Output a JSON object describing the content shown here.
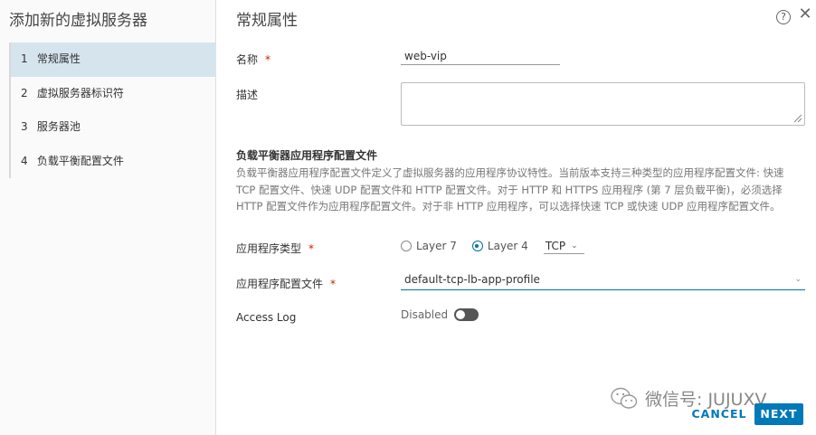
{
  "wizard": {
    "title": "添加新的虚拟服务器"
  },
  "steps": [
    {
      "num": "1",
      "label": "常规属性"
    },
    {
      "num": "2",
      "label": "虚拟服务器标识符"
    },
    {
      "num": "3",
      "label": "服务器池"
    },
    {
      "num": "4",
      "label": "负载平衡配置文件"
    }
  ],
  "page": {
    "title": "常规属性",
    "help": "?",
    "close": "✕"
  },
  "fields": {
    "name_label": "名称",
    "name_value": "web-vip",
    "required_mark": "*",
    "desc_label": "描述",
    "desc_value": ""
  },
  "profile_section": {
    "title": "负载平衡器应用程序配置文件",
    "description": "负载平衡器应用程序配置文件定义了虚拟服务器的应用程序协议特性。当前版本支持三种类型的应用程序配置文件: 快速 TCP 配置文件、快速 UDP 配置文件和 HTTP 配置文件。对于 HTTP 和 HTTPS 应用程序 (第 7 层负载平衡)，必须选择 HTTP 配置文件作为应用程序配置文件。对于非 HTTP 应用程序，可以选择快速 TCP 或快速 UDP 应用程序配置文件。",
    "app_type_label": "应用程序类型",
    "layer7": "Layer 7",
    "layer4": "Layer 4",
    "selected_layer": "Layer 4",
    "protocol": "TCP",
    "profile_label": "应用程序配置文件",
    "profile_value": "default-tcp-lb-app-profile"
  },
  "access_log": {
    "label": "Access Log",
    "state": "Disabled",
    "enabled": false
  },
  "watermark": {
    "text": "微信号: JUJUXV"
  },
  "buttons": {
    "cancel": "CANCEL",
    "next": "NEXT"
  },
  "colors": {
    "primary": "#0079b8",
    "required": "#c92100",
    "active_step": "#d6e4ee"
  },
  "icons": {
    "help": "help-icon",
    "close": "close-icon",
    "chevron": "chevron-down-icon",
    "wechat": "wechat-icon"
  }
}
